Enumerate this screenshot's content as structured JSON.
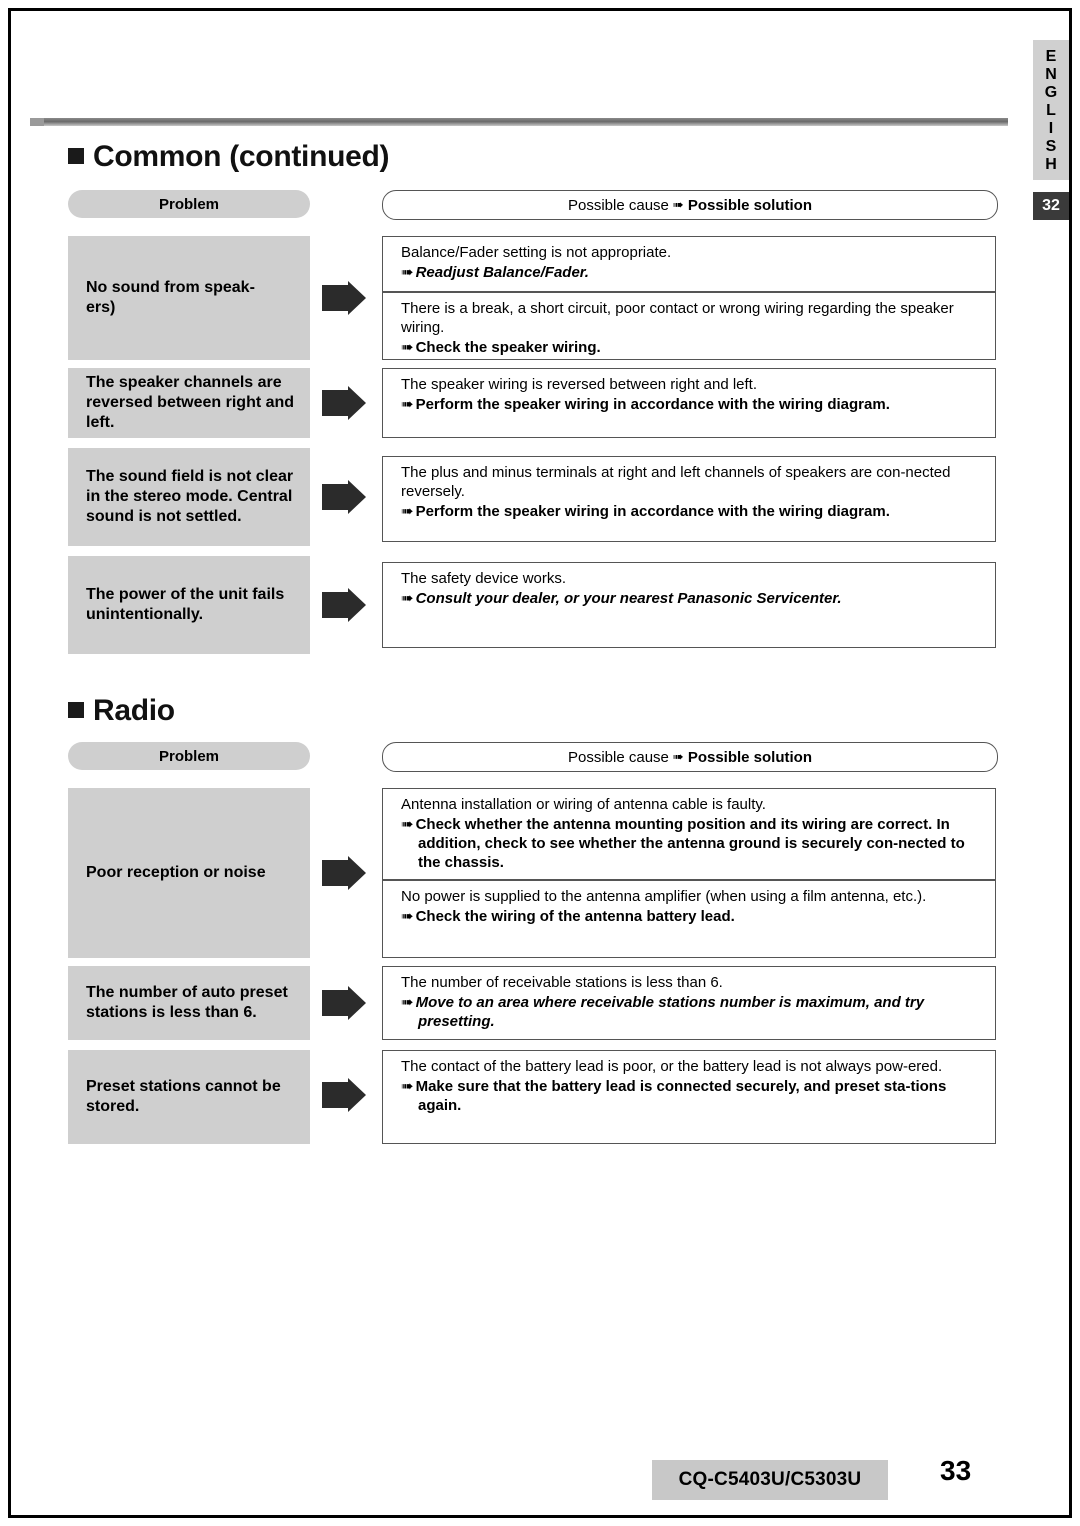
{
  "page": {
    "language_tab": [
      "E",
      "N",
      "G",
      "L",
      "I",
      "S",
      "H"
    ],
    "section_number": "32",
    "footer_model": "CQ-C5403U/C5303U",
    "footer_page": "33"
  },
  "headings": {
    "common": "Common (continued)",
    "radio": "Radio"
  },
  "table_headers": {
    "problem": "Problem",
    "cause_prefix": "Possible cause",
    "cause_arrow": "➠",
    "cause_suffix": "Possible solution"
  },
  "common_rows": [
    {
      "problem": "No sound from speak-\ners)",
      "entries": [
        {
          "cause": "Balance/Fader setting is not appropriate.",
          "answer": "Readjust Balance/Fader.",
          "style": "italic"
        },
        {
          "cause": "There is a break, a short circuit, poor contact or wrong wiring regarding the speaker wiring.",
          "answer": "Check the speaker wiring.",
          "style": "bold"
        }
      ]
    },
    {
      "problem": "The speaker channels are reversed between right and left.",
      "entries": [
        {
          "cause": "The speaker wiring is reversed between right and left.",
          "answer": "Perform the speaker wiring in accordance with the wiring diagram.",
          "style": "bold"
        }
      ]
    },
    {
      "problem": "The sound field is not clear in the stereo mode. Central sound is not settled.",
      "entries": [
        {
          "cause": "The plus and minus terminals at right and left channels of speakers are con-nected reversely.",
          "answer": "Perform the speaker wiring in accordance with the wiring diagram.",
          "style": "bold"
        }
      ]
    },
    {
      "problem": "The power of the unit fails unintentionally.",
      "entries": [
        {
          "cause": "The safety device works.",
          "answer": "Consult your dealer, or your nearest Panasonic Servicenter.",
          "style": "italic"
        }
      ]
    }
  ],
  "radio_rows": [
    {
      "problem": "Poor reception or noise",
      "entries": [
        {
          "cause": "Antenna installation or wiring of antenna cable is faulty.",
          "answer": "Check whether the antenna mounting position and its wiring are correct. In addition, check to see whether the antenna ground is securely con-nected to the chassis.",
          "style": "bold"
        },
        {
          "cause": "No power is supplied to the antenna amplifier (when using a film antenna, etc.).",
          "answer": "Check the wiring of the antenna battery lead.",
          "style": "bold"
        }
      ]
    },
    {
      "problem": "The number of auto preset stations is less than 6.",
      "entries": [
        {
          "cause": "The number of receivable stations is less than 6.",
          "answer": "Move to an area where receivable stations number is maximum, and try presetting.",
          "style": "italic"
        }
      ]
    },
    {
      "problem": "Preset stations cannot be stored.",
      "entries": [
        {
          "cause": "The contact of the battery lead is poor, or the battery lead is not always pow-ered.",
          "answer": "Make sure that the battery lead is connected securely, and preset sta-tions again.",
          "style": "bold"
        }
      ]
    }
  ]
}
